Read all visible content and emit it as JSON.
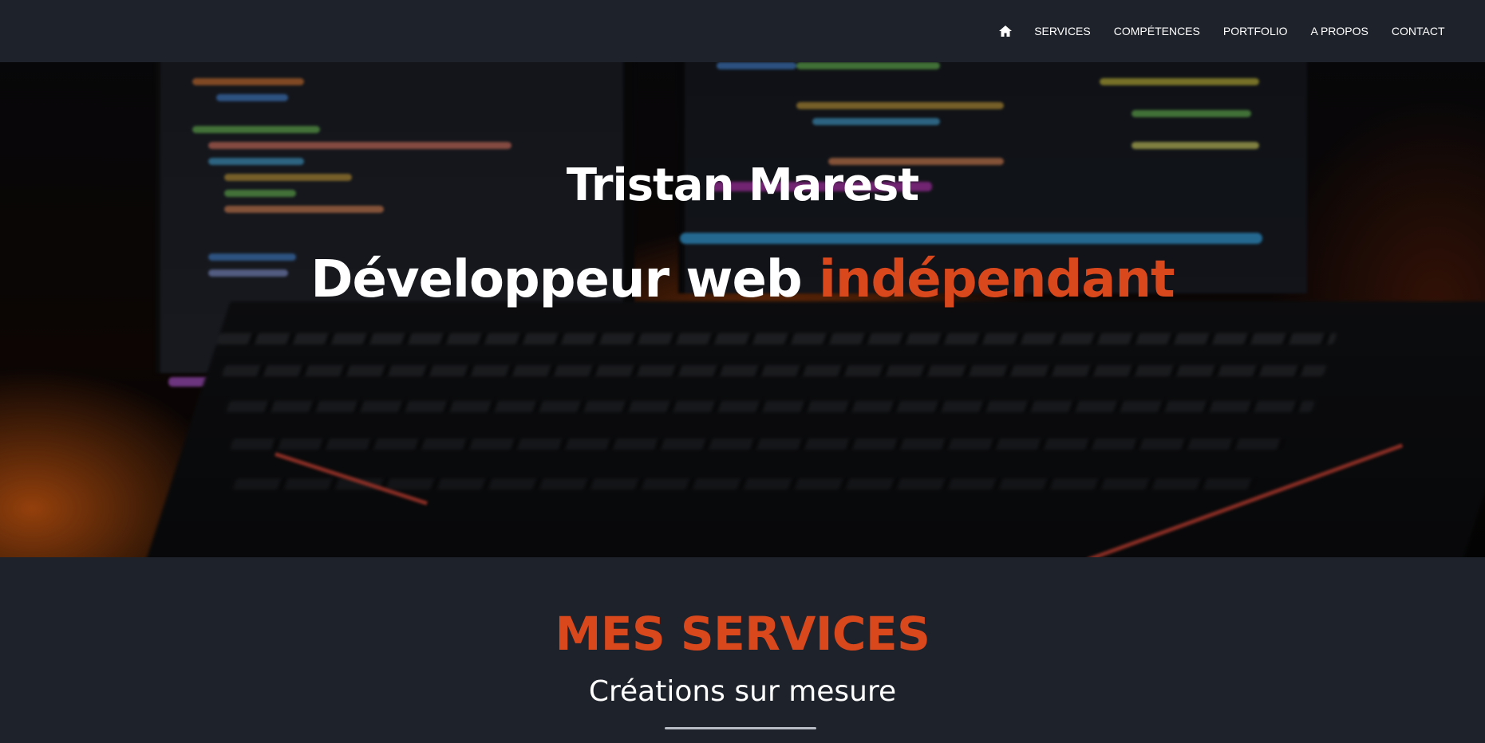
{
  "nav": {
    "items": [
      {
        "label": "SERVICES"
      },
      {
        "label": "COMPÉTENCES"
      },
      {
        "label": "PORTFOLIO"
      },
      {
        "label": "A PROPOS"
      },
      {
        "label": "CONTACT"
      }
    ],
    "home_icon": "home-icon"
  },
  "hero": {
    "title": "Tristan Marest",
    "subtitle_main": "Développeur web ",
    "subtitle_accent": "indépendant",
    "background_image": "blurred laptop keyboard with code monitors and orange backlight"
  },
  "services": {
    "title": "MES SERVICES",
    "subtitle": "Créations sur mesure"
  },
  "colors": {
    "accent": "#d9471d",
    "background": "#1e222a",
    "text": "#ffffff"
  }
}
